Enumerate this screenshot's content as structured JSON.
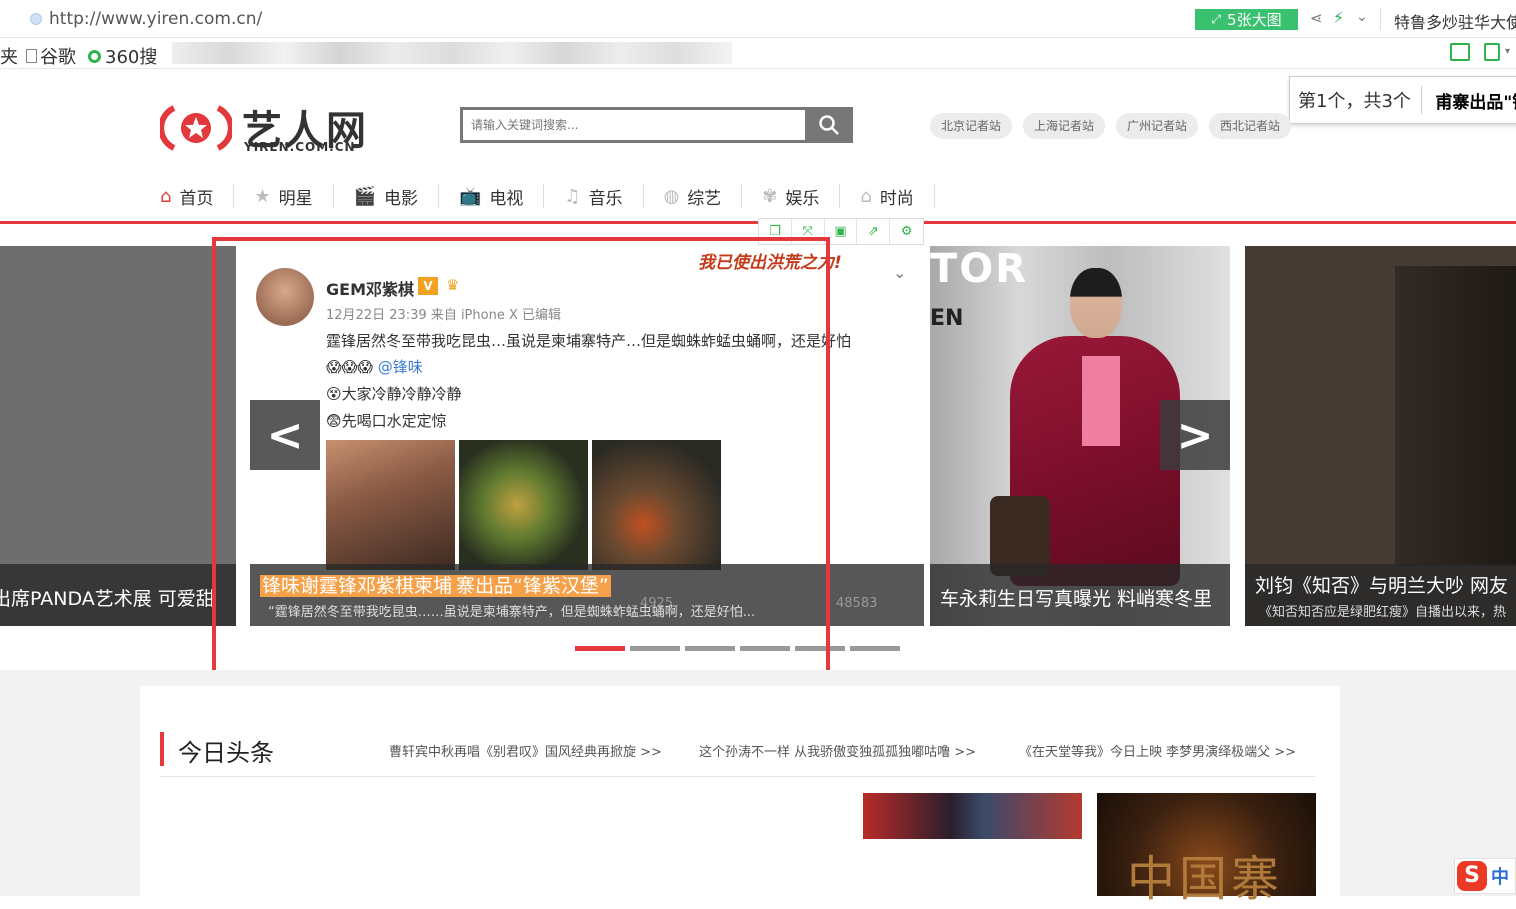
{
  "browser": {
    "url": "http://www.yiren.com.cn/",
    "big_picture_label": "5张大图",
    "news_ticker": "特鲁多炒驻华大使",
    "bookmarks": [
      "夹",
      "谷歌",
      "360搜"
    ]
  },
  "find_bar": {
    "count": "第1个，共3个",
    "term": "甫寨出品\"锋"
  },
  "site": {
    "logo_text": "艺人网",
    "logo_sub": "YIREN.COM.CN",
    "search_placeholder": "请输入关键词搜索...",
    "stations": [
      "北京记者站",
      "上海记者站",
      "广州记者站",
      "西北记者站"
    ],
    "nav": [
      {
        "label": "首页",
        "icon": "home-icon"
      },
      {
        "label": "明星",
        "icon": "star-icon"
      },
      {
        "label": "电影",
        "icon": "film-icon"
      },
      {
        "label": "电视",
        "icon": "tv-icon"
      },
      {
        "label": "音乐",
        "icon": "music-icon"
      },
      {
        "label": "综艺",
        "icon": "variety-icon"
      },
      {
        "label": "娱乐",
        "icon": "entertainment-icon"
      },
      {
        "label": "时尚",
        "icon": "fashion-icon"
      }
    ],
    "accent_color": "#e4393c"
  },
  "carousel": {
    "left": {
      "title": "出席PANDA艺术展 可爱甜"
    },
    "main": {
      "weibo_name": "GEM邓紫棋",
      "weibo_v": "V",
      "weibo_meta": "12月22日 23:39 来自 iPhone X  已编辑",
      "weibo_text": "霆锋居然冬至带我吃昆虫…虽说是柬埔寨特产…但是蜘蛛蚱蜢虫蛹啊，还是好怕",
      "weibo_mention": "@锋味",
      "weibo_line2": "大家冷静冷静冷静",
      "weibo_line3": "先喝口水定定惊",
      "banner": "我已使出洪荒之力!",
      "stat1": "4925",
      "stat2": "48583",
      "title_pre": "锋味谢霆锋邓紫棋柬埔",
      "title_highlight": "寨出品“锋紫汉堡”",
      "subtitle": "“霆锋居然冬至带我吃昆虫……虽说是柬埔寨特产，但是蜘蛛蚱蜢虫蛹啊，还是好怕..."
    },
    "right1": {
      "title": "车永莉生日写真曝光 料峭寒冬里",
      "sign_tor": "TOR",
      "sign_en": "EN"
    },
    "right2": {
      "title": "刘钧《知否》与明兰大吵 网友",
      "subtitle": "《知否知否应是绿肥红瘦》自播出以来，热"
    },
    "prev_label": "<",
    "next_label": ">",
    "dots": 6,
    "active_dot": 0
  },
  "image_tools": [
    "copy-icon",
    "expand-icon",
    "save-icon",
    "share-icon",
    "settings-icon"
  ],
  "today": {
    "title": "今日头条",
    "headlines": [
      "曹轩宾中秋再唱《别君叹》国风经典再掀旋 >>",
      "这个孙涛不一样 从我骄傲变独孤孤独嘟咕噜 >>",
      "《在天堂等我》今日上映 李梦男演绎极端父 >>"
    ],
    "thumb2_glyph": "中国寨"
  },
  "ime": {
    "label": "中"
  }
}
